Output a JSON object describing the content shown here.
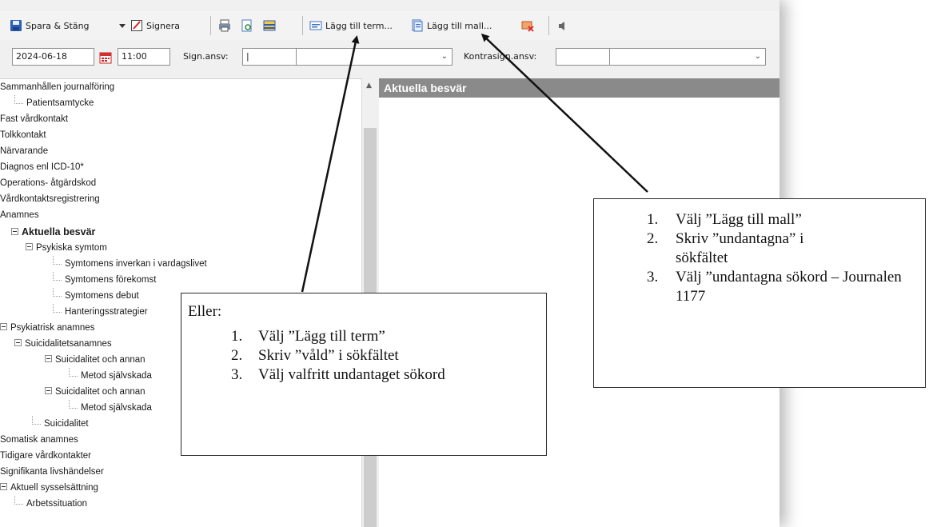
{
  "toolbar": {
    "save_close": "Spara & Stäng",
    "sign": "Signera",
    "add_term": "Lägg till term...",
    "add_template": "Lägg till mall..."
  },
  "datebar": {
    "date": "2024-06-18",
    "time": "11:00",
    "sign_resp_label": "Sign.ansv:",
    "sign_resp_value": "|",
    "cosign_label": "Kontrasign.ansv:"
  },
  "tree": [
    {
      "label": "Sammanhållen journalföring"
    },
    {
      "label": "Patientsamtycke"
    },
    {
      "label": "Fast vårdkontakt"
    },
    {
      "label": "Tolkkontakt"
    },
    {
      "label": "Närvarande"
    },
    {
      "label": "Diagnos enl ICD-10*"
    },
    {
      "label": "Operations- åtgärdskod"
    },
    {
      "label": "Vårdkontaktsregistrering"
    },
    {
      "label": "Anamnes"
    },
    {
      "label": "Aktuella besvär"
    },
    {
      "label": "Psykiska symtom"
    },
    {
      "label": "Symtomens inverkan i vardagslivet"
    },
    {
      "label": "Symtomens förekomst"
    },
    {
      "label": "Symtomens debut"
    },
    {
      "label": "Hanteringsstrategier"
    },
    {
      "label": "Psykiatrisk anamnes"
    },
    {
      "label": "Suicidalitetsanamnes"
    },
    {
      "label": "Suicidalitet och annan"
    },
    {
      "label": "Metod självskada"
    },
    {
      "label": "Suicidalitet och annan"
    },
    {
      "label": "Metod självskada"
    },
    {
      "label": "Suicidalitet"
    },
    {
      "label": "Somatisk anamnes"
    },
    {
      "label": "Tidigare vårdkontakter"
    },
    {
      "label": "Signifikanta livshändelser"
    },
    {
      "label": "Aktuell sysselsättning"
    },
    {
      "label": "Arbetssituation"
    }
  ],
  "pane": {
    "title": "Aktuella besvär"
  },
  "callout_template": {
    "steps": [
      {
        "num": "1.",
        "text": "Välj ”Lägg till mall”"
      },
      {
        "num": "2.",
        "text": "Skriv ”undantagna” i sökfältet"
      },
      {
        "num": "3.",
        "text": "Välj ”undantagna sökord – Journalen 1177"
      }
    ]
  },
  "callout_term": {
    "intro": "Eller:",
    "steps": [
      {
        "num": "1.",
        "text": "Välj ”Lägg till term”"
      },
      {
        "num": "2.",
        "text": "Skriv ”våld” i sökfältet"
      },
      {
        "num": "3.",
        "text": "Välj valfritt undantaget sökord"
      }
    ]
  },
  "colors": {
    "pane_header": "#8a8a8a",
    "toolbar_bg": "#f3f3f3",
    "date_icon_red": "#d03030"
  },
  "icons": [
    "save-icon",
    "dropdown-arrow-icon",
    "sign-icon",
    "print-icon",
    "preview-icon",
    "list-icon",
    "add-term-icon",
    "add-template-icon",
    "template-edit-icon",
    "speaker-icon",
    "calendar-icon",
    "expand-icon",
    "arrow-icon"
  ]
}
